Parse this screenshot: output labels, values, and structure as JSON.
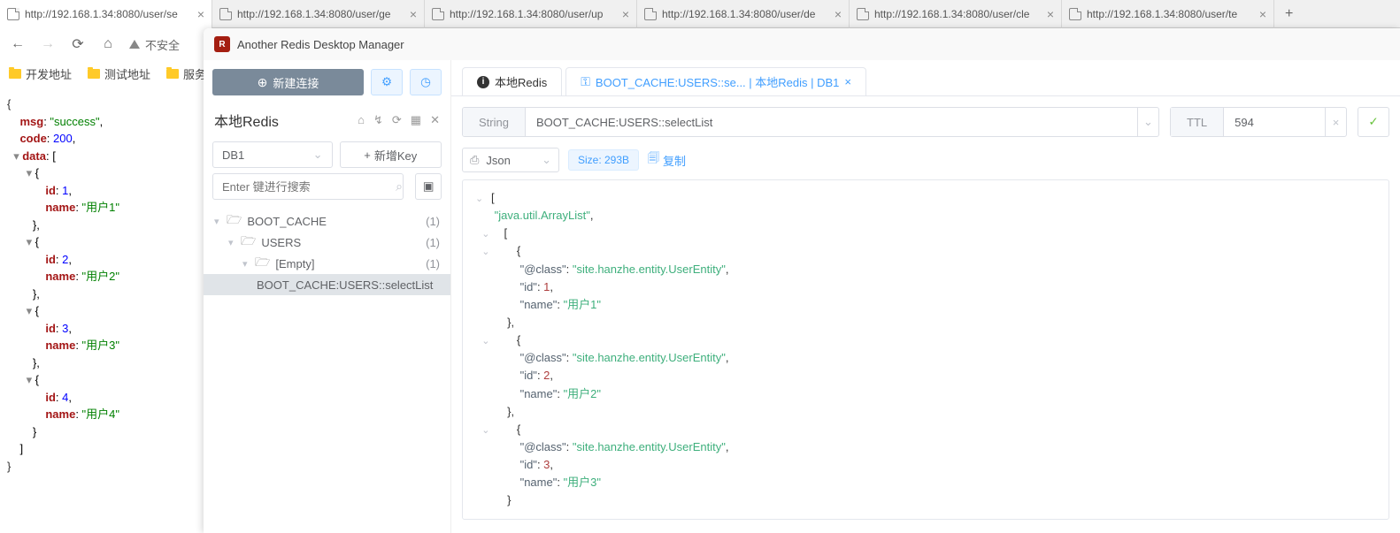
{
  "browser": {
    "tabs": [
      {
        "title": "http://192.168.1.34:8080/user/se",
        "active": true
      },
      {
        "title": "http://192.168.1.34:8080/user/ge",
        "active": false
      },
      {
        "title": "http://192.168.1.34:8080/user/up",
        "active": false
      },
      {
        "title": "http://192.168.1.34:8080/user/de",
        "active": false
      },
      {
        "title": "http://192.168.1.34:8080/user/cle",
        "active": false
      },
      {
        "title": "http://192.168.1.34:8080/user/te",
        "active": false
      }
    ],
    "insecure_label": "不安全",
    "bookmarks": [
      "开发地址",
      "测试地址",
      "服务"
    ]
  },
  "json_response": {
    "msg_key": "msg",
    "msg_val": "\"success\"",
    "code_key": "code",
    "code_val": "200",
    "data_key": "data",
    "items": [
      {
        "id": "1",
        "name": "\"用户1\""
      },
      {
        "id": "2",
        "name": "\"用户2\""
      },
      {
        "id": "3",
        "name": "\"用户3\""
      },
      {
        "id": "4",
        "name": "\"用户4\""
      }
    ],
    "id_label": "id",
    "name_label": "name"
  },
  "redis": {
    "app_title": "Another Redis Desktop Manager",
    "new_conn": "新建连接",
    "connection_name": "本地Redis",
    "db_selected": "DB1",
    "new_key_btn": "新增Key",
    "search_placeholder": "Enter 键进行搜索",
    "tree": {
      "root": {
        "label": "BOOT_CACHE",
        "count": "(1)"
      },
      "users": {
        "label": "USERS",
        "count": "(1)"
      },
      "empty": {
        "label": "[Empty]",
        "count": "(1)"
      },
      "selected_key": "BOOT_CACHE:USERS::selectList"
    },
    "tabs": {
      "home": "本地Redis",
      "active": "BOOT_CACHE:USERS::se... | 本地Redis | DB1"
    },
    "key_header": {
      "type_label": "String",
      "key_value": "BOOT_CACHE:USERS::selectList",
      "ttl_label": "TTL",
      "ttl_value": "594"
    },
    "viewer": {
      "format": "Json",
      "size": "Size: 293B",
      "copy": "复制"
    },
    "value_json": {
      "root_type": "\"java.util.ArrayList\"",
      "class_key": "\"@class\"",
      "class_val": "\"site.hanzhe.entity.UserEntity\"",
      "id_key": "\"id\"",
      "name_key": "\"name\"",
      "items": [
        {
          "id": "1",
          "name": "\"用户1\""
        },
        {
          "id": "2",
          "name": "\"用户2\""
        },
        {
          "id": "3",
          "name": "\"用户3\""
        }
      ]
    }
  }
}
